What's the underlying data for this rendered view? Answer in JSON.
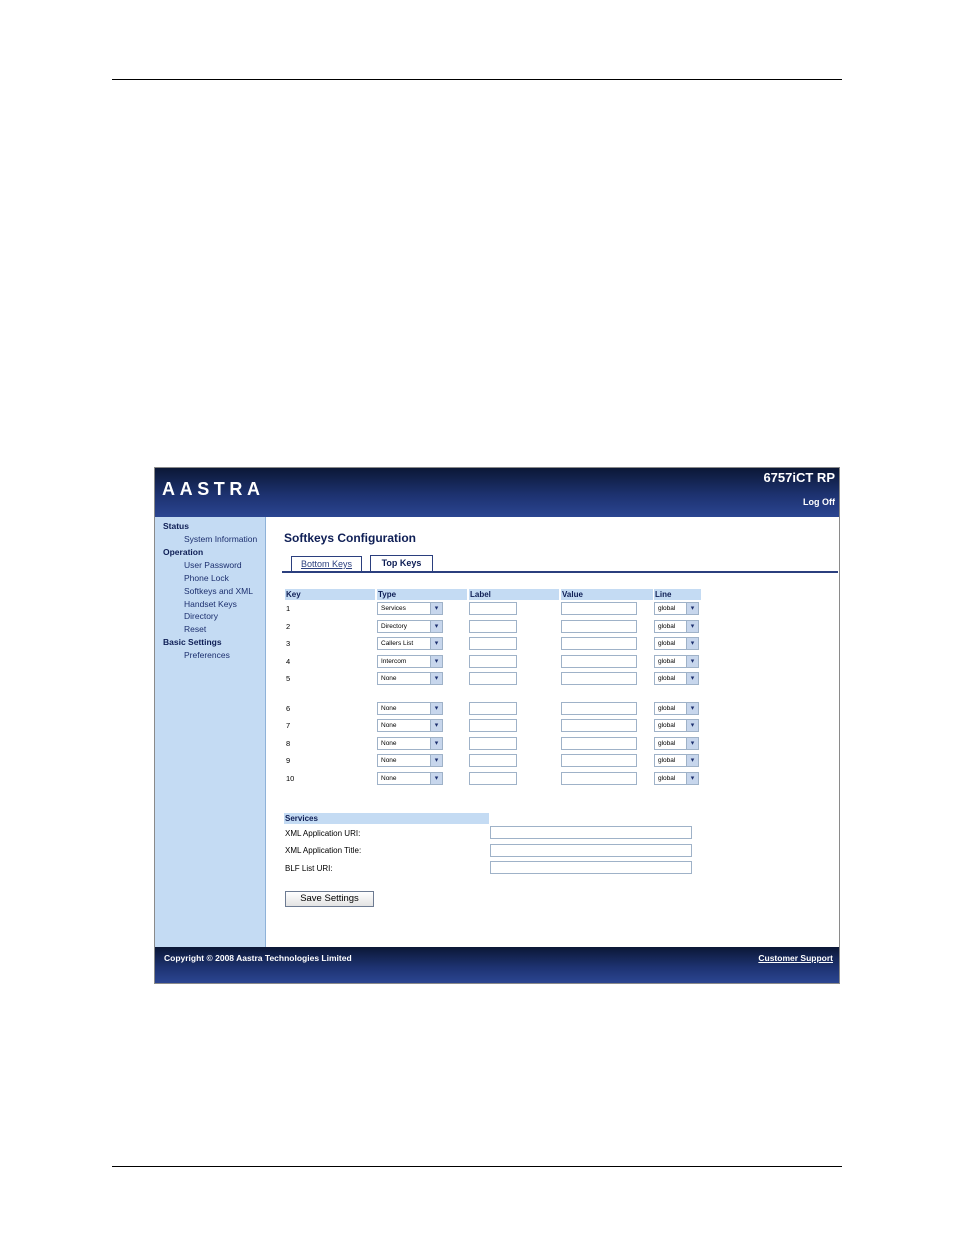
{
  "header": {
    "logo_text": "AASTRA",
    "model": "6757iCT RP",
    "logoff_label": "Log Off"
  },
  "sidebar": {
    "sections": [
      {
        "title": "Status",
        "items": [
          "System Information"
        ]
      },
      {
        "title": "Operation",
        "items": [
          "User Password",
          "Phone Lock",
          "Softkeys and XML",
          "Handset Keys",
          "Directory",
          "Reset"
        ]
      },
      {
        "title": "Basic Settings",
        "items": [
          "Preferences"
        ]
      }
    ]
  },
  "main": {
    "title": "Softkeys Configuration",
    "tabs": [
      "Bottom Keys",
      "Top Keys"
    ],
    "active_tab": "Top Keys",
    "columns": [
      "Key",
      "Type",
      "Label",
      "Value",
      "Line"
    ],
    "rows": [
      {
        "key": "1",
        "type": "Services",
        "label": "",
        "value": "",
        "line": "global"
      },
      {
        "key": "2",
        "type": "Directory",
        "label": "",
        "value": "",
        "line": "global"
      },
      {
        "key": "3",
        "type": "Callers List",
        "label": "",
        "value": "",
        "line": "global"
      },
      {
        "key": "4",
        "type": "Intercom",
        "label": "",
        "value": "",
        "line": "global"
      },
      {
        "key": "5",
        "type": "None",
        "label": "",
        "value": "",
        "line": "global"
      },
      {
        "key": "6",
        "type": "None",
        "label": "",
        "value": "",
        "line": "global"
      },
      {
        "key": "7",
        "type": "None",
        "label": "",
        "value": "",
        "line": "global"
      },
      {
        "key": "8",
        "type": "None",
        "label": "",
        "value": "",
        "line": "global"
      },
      {
        "key": "9",
        "type": "None",
        "label": "",
        "value": "",
        "line": "global"
      },
      {
        "key": "10",
        "type": "None",
        "label": "",
        "value": "",
        "line": "global"
      }
    ],
    "services": {
      "heading": "Services",
      "fields": [
        {
          "label": "XML Application URI:",
          "value": ""
        },
        {
          "label": "XML Application Title:",
          "value": ""
        },
        {
          "label": "BLF List URI:",
          "value": ""
        }
      ]
    },
    "save_label": "Save Settings"
  },
  "footer": {
    "copyright": "Copyright © 2008 Aastra Technologies Limited",
    "support_label": "Customer Support"
  },
  "colors": {
    "header_dark": "#0b1736",
    "header_light": "#2b4591",
    "sidebar_bg": "#c4dbf3",
    "accent": "#0e1e55"
  }
}
